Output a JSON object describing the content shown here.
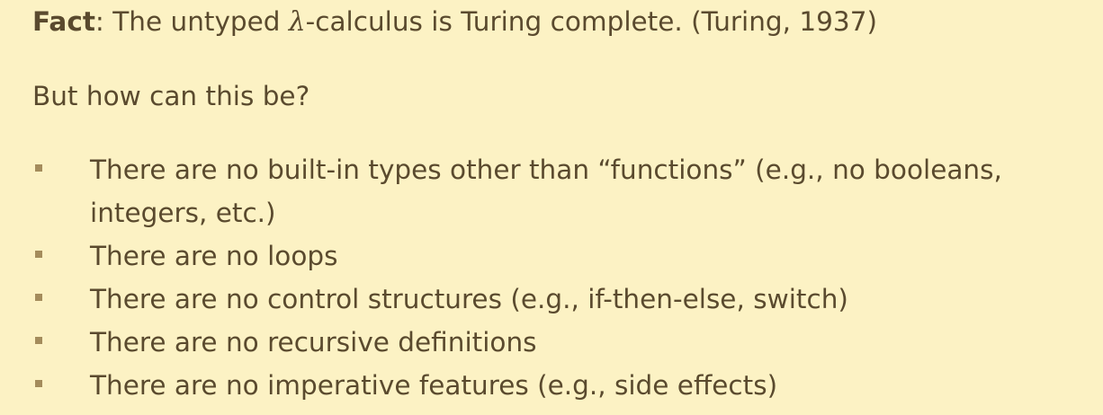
{
  "fact": {
    "label": "Fact",
    "sep": ":",
    "text_before": " The untyped ",
    "lambda": "λ",
    "text_after": "-calculus is Turing complete. (Turing, 1937)"
  },
  "question": "But how can this be?",
  "bullets": [
    "There are no built-in types other than “functions” (e.g., no booleans, integers, etc.)",
    "There are no loops",
    "There are no control structures (e.g., if-then-else, switch)",
    "There are no recursive definitions",
    "There are no imperative features (e.g., side effects)"
  ],
  "colors": {
    "background": "#fcf2c4",
    "text": "#5a4a2e",
    "bullet": "#a48c5c"
  }
}
